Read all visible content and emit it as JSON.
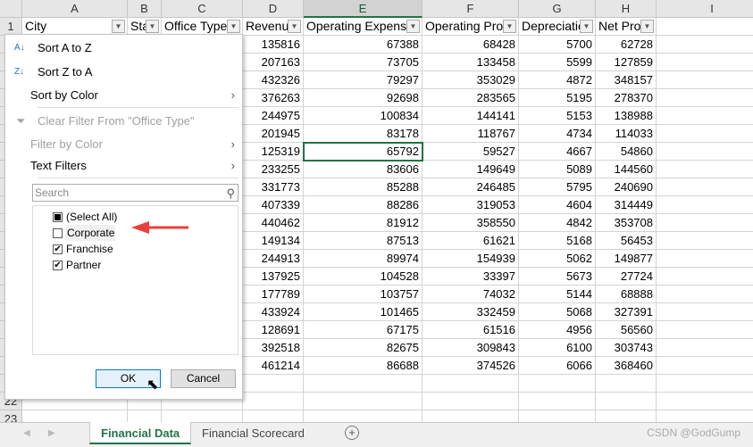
{
  "columns": [
    "A",
    "B",
    "C",
    "D",
    "E",
    "F",
    "G",
    "H",
    "I"
  ],
  "headers": [
    "City",
    "Sta",
    "Office Type",
    "Revenu",
    "Operating Expense",
    "Operating Prof",
    "Depreciatic",
    "Net Pro"
  ],
  "rows": [
    [
      "135816",
      "67388",
      "68428",
      "5700",
      "62728"
    ],
    [
      "207163",
      "73705",
      "133458",
      "5599",
      "127859"
    ],
    [
      "432326",
      "79297",
      "353029",
      "4872",
      "348157"
    ],
    [
      "376263",
      "92698",
      "283565",
      "5195",
      "278370"
    ],
    [
      "244975",
      "100834",
      "144141",
      "5153",
      "138988"
    ],
    [
      "201945",
      "83178",
      "118767",
      "4734",
      "114033"
    ],
    [
      "125319",
      "65792",
      "59527",
      "4667",
      "54860"
    ],
    [
      "233255",
      "83606",
      "149649",
      "5089",
      "144560"
    ],
    [
      "331773",
      "85288",
      "246485",
      "5795",
      "240690"
    ],
    [
      "407339",
      "88286",
      "319053",
      "4604",
      "314449"
    ],
    [
      "440462",
      "81912",
      "358550",
      "4842",
      "353708"
    ],
    [
      "149134",
      "87513",
      "61621",
      "5168",
      "56453"
    ],
    [
      "244913",
      "89974",
      "154939",
      "5062",
      "149877"
    ],
    [
      "137925",
      "104528",
      "33397",
      "5673",
      "27724"
    ],
    [
      "177789",
      "103757",
      "74032",
      "5144",
      "68888"
    ],
    [
      "433924",
      "101465",
      "332459",
      "5068",
      "327391"
    ],
    [
      "128691",
      "67175",
      "61516",
      "4956",
      "56560"
    ],
    [
      "392518",
      "82675",
      "309843",
      "6100",
      "303743"
    ],
    [
      "461214",
      "86688",
      "374526",
      "6066",
      "368460"
    ]
  ],
  "row_numbers": [
    "1",
    "22",
    "23"
  ],
  "menu": {
    "sort_az": "Sort A to Z",
    "sort_za": "Sort Z to A",
    "sort_color": "Sort by Color",
    "clear_filter": "Clear Filter From \"Office Type\"",
    "filter_color": "Filter by Color",
    "text_filters": "Text Filters",
    "search_placeholder": "Search",
    "items": [
      {
        "label": "(Select All)",
        "state": "partial"
      },
      {
        "label": "Corporate",
        "state": "unchecked"
      },
      {
        "label": "Franchise",
        "state": "checked"
      },
      {
        "label": "Partner",
        "state": "checked"
      }
    ],
    "ok": "OK",
    "cancel": "Cancel"
  },
  "annotation_color": "#e8413c",
  "tabs": {
    "active": "Financial Data",
    "other": "Financial Scorecard"
  },
  "watermark": "CSDN @GodGump"
}
